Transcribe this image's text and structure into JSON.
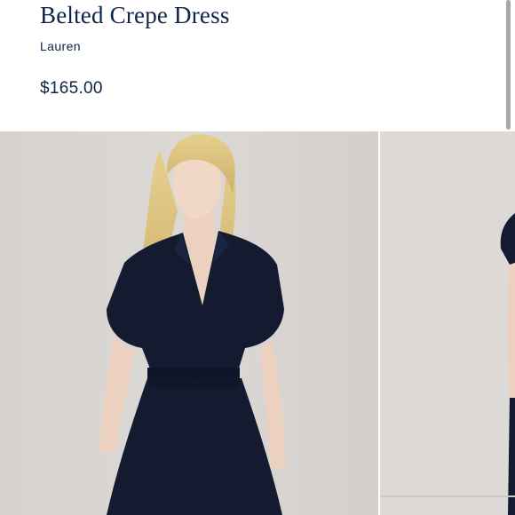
{
  "product": {
    "title": "Belted Crepe Dress",
    "brand": "Lauren",
    "price": "$165.00"
  },
  "colors": {
    "text": "#0f2447",
    "background_backdrop": "#dad6d3",
    "dress": "#141b30",
    "scrollbar": "#a7a7a7"
  },
  "gallery": {
    "images": [
      {
        "alt": "",
        "name": "product-image-main"
      },
      {
        "alt": "",
        "name": "product-image-next"
      }
    ]
  }
}
